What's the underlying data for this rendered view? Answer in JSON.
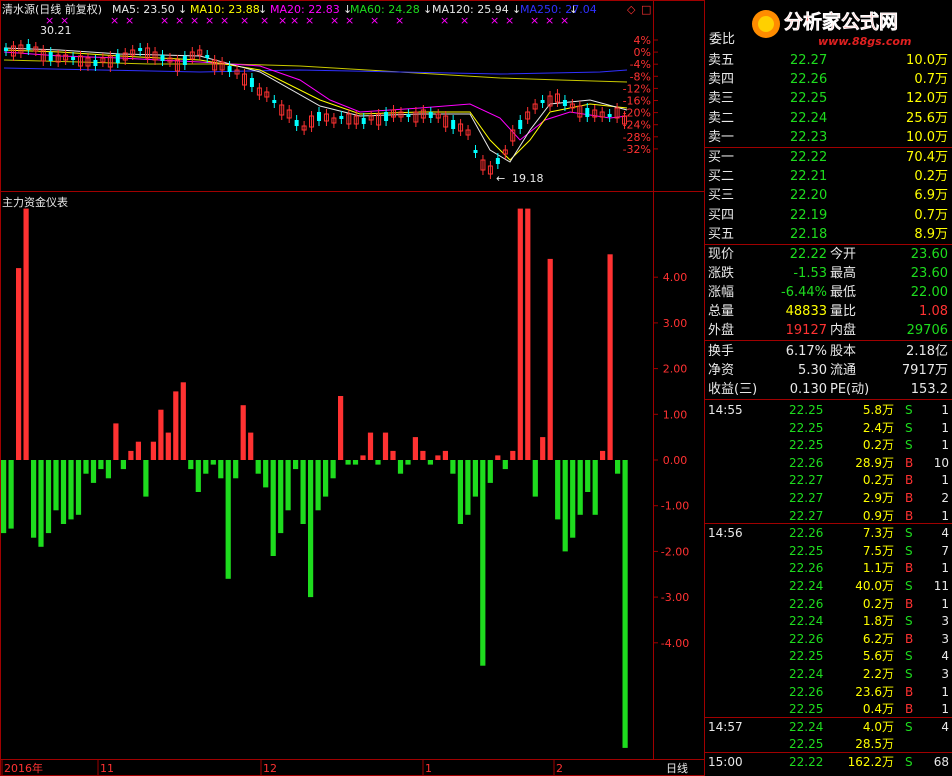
{
  "colors": {
    "red": "#ff3232",
    "green": "#1edc1e",
    "axis": "#a00000",
    "white": "#e8e8e8",
    "yellow": "#ffff00",
    "cyan": "#00ffff",
    "magenta": "#ff00ff",
    "blue": "#3030ff",
    "olive": "#c8c800",
    "label": "#c0c0c0"
  },
  "header": {
    "stock": "清水源(日线 前复权)",
    "ma5": "MA5: 23.50",
    "ma10": "MA10: 23.88",
    "ma20": "MA20: 22.83",
    "ma60": "MA60: 24.28",
    "ma120": "MA120: 25.94",
    "ma250": "MA250: 27.04"
  },
  "price_panel": {
    "high_label": "30.21",
    "low_label": "19.18",
    "pct_ticks": [
      "4%",
      "0%",
      "-4%",
      "-8%",
      "-12%",
      "-16%",
      "-20%",
      "-24%",
      "-28%",
      "-32%"
    ]
  },
  "indicator_panel": {
    "title": "主力资金仪表",
    "y_ticks": [
      "4.00",
      "3.00",
      "2.00",
      "1.00",
      "0.00",
      "-1.00",
      "-2.00",
      "-3.00",
      "-4.00"
    ]
  },
  "date_axis": {
    "labels": [
      "2016年",
      "11",
      "12",
      "1",
      "2"
    ],
    "period": "日线"
  },
  "chart_data": {
    "type": "bar",
    "title": "主力资金仪表",
    "ylim": [
      -6.3,
      5.3
    ],
    "values": [
      -1.6,
      -1.5,
      4.2,
      5.5,
      -1.7,
      -1.9,
      -1.6,
      -1.1,
      -1.4,
      -1.3,
      -1.2,
      -0.3,
      -0.5,
      -0.2,
      -0.4,
      0.8,
      -0.2,
      0.2,
      0.4,
      -0.8,
      0.4,
      1.1,
      0.6,
      1.5,
      1.7,
      -0.2,
      -0.7,
      -0.3,
      -0.1,
      -0.4,
      -2.6,
      -0.4,
      1.2,
      0.6,
      -0.3,
      -0.6,
      -2.1,
      -1.6,
      -1.1,
      -0.2,
      -1.4,
      -3.0,
      -1.1,
      -0.8,
      -0.4,
      1.4,
      -0.1,
      -0.1,
      0.1,
      0.6,
      -0.1,
      0.6,
      0.2,
      -0.3,
      -0.1,
      0.5,
      0.2,
      -0.1,
      0.1,
      0.2,
      -0.3,
      -1.4,
      -1.2,
      -0.8,
      -4.5,
      -0.5,
      0.1,
      -0.2,
      0.2,
      5.5,
      5.5,
      -0.8,
      0.5,
      4.4,
      -1.3,
      -2.0,
      -1.7,
      -1.2,
      -0.7,
      -1.2,
      0.2,
      4.5,
      -0.3,
      -6.3
    ]
  },
  "quote": {
    "webi_label": "委比",
    "asks": [
      {
        "label": "卖五",
        "price": "22.27",
        "vol": "10.0万"
      },
      {
        "label": "卖四",
        "price": "22.26",
        "vol": "0.7万"
      },
      {
        "label": "卖三",
        "price": "22.25",
        "vol": "12.0万"
      },
      {
        "label": "卖二",
        "price": "22.24",
        "vol": "25.6万"
      },
      {
        "label": "卖一",
        "price": "22.23",
        "vol": "10.0万"
      }
    ],
    "bids": [
      {
        "label": "买一",
        "price": "22.22",
        "vol": "70.4万"
      },
      {
        "label": "买二",
        "price": "22.21",
        "vol": "0.2万"
      },
      {
        "label": "买三",
        "price": "22.20",
        "vol": "6.9万"
      },
      {
        "label": "买四",
        "price": "22.19",
        "vol": "0.7万"
      },
      {
        "label": "买五",
        "price": "22.18",
        "vol": "8.9万"
      }
    ],
    "stats": [
      {
        "l1": "现价",
        "v1": "22.22",
        "l2": "今开",
        "v2": "23.60"
      },
      {
        "l1": "涨跌",
        "v1": "-1.53",
        "l2": "最高",
        "v2": "23.60"
      },
      {
        "l1": "涨幅",
        "v1": "-6.44%",
        "l2": "最低",
        "v2": "22.00"
      },
      {
        "l1": "总量",
        "v1": "48833",
        "l2": "量比",
        "v2": "1.08"
      },
      {
        "l1": "外盘",
        "v1": "19127",
        "l2": "内盘",
        "v2": "29706"
      }
    ],
    "fund": [
      {
        "l1": "换手",
        "v1": "6.17%",
        "l2": "股本",
        "v2": "2.18亿"
      },
      {
        "l1": "净资",
        "v1": "5.30",
        "l2": "流通",
        "v2": "7917万"
      },
      {
        "l1": "收益(三)",
        "v1": "0.130",
        "l2": "PE(动)",
        "v2": "153.2"
      }
    ],
    "ticks": [
      {
        "time": "14:55",
        "price": "22.25",
        "vol": "5.8万",
        "bs": "S",
        "n": "1"
      },
      {
        "time": "",
        "price": "22.25",
        "vol": "2.4万",
        "bs": "S",
        "n": "1"
      },
      {
        "time": "",
        "price": "22.25",
        "vol": "0.2万",
        "bs": "S",
        "n": "1"
      },
      {
        "time": "",
        "price": "22.26",
        "vol": "28.9万",
        "bs": "B",
        "n": "10"
      },
      {
        "time": "",
        "price": "22.27",
        "vol": "0.2万",
        "bs": "B",
        "n": "1"
      },
      {
        "time": "",
        "price": "22.27",
        "vol": "2.9万",
        "bs": "B",
        "n": "2"
      },
      {
        "time": "",
        "price": "22.27",
        "vol": "0.9万",
        "bs": "B",
        "n": "1"
      },
      {
        "time": "14:56",
        "price": "22.26",
        "vol": "7.3万",
        "bs": "S",
        "n": "4"
      },
      {
        "time": "",
        "price": "22.25",
        "vol": "7.5万",
        "bs": "S",
        "n": "7"
      },
      {
        "time": "",
        "price": "22.26",
        "vol": "1.1万",
        "bs": "B",
        "n": "1"
      },
      {
        "time": "",
        "price": "22.24",
        "vol": "40.0万",
        "bs": "S",
        "n": "11"
      },
      {
        "time": "",
        "price": "22.26",
        "vol": "0.2万",
        "bs": "B",
        "n": "1"
      },
      {
        "time": "",
        "price": "22.24",
        "vol": "1.8万",
        "bs": "S",
        "n": "3"
      },
      {
        "time": "",
        "price": "22.26",
        "vol": "6.2万",
        "bs": "B",
        "n": "3"
      },
      {
        "time": "",
        "price": "22.25",
        "vol": "5.6万",
        "bs": "S",
        "n": "4"
      },
      {
        "time": "",
        "price": "22.24",
        "vol": "2.2万",
        "bs": "S",
        "n": "3"
      },
      {
        "time": "",
        "price": "22.26",
        "vol": "23.6万",
        "bs": "B",
        "n": "1"
      },
      {
        "time": "",
        "price": "22.25",
        "vol": "0.4万",
        "bs": "B",
        "n": "1"
      },
      {
        "time": "14:57",
        "price": "22.24",
        "vol": "4.0万",
        "bs": "S",
        "n": "4"
      },
      {
        "time": "",
        "price": "22.25",
        "vol": "28.5万",
        "bs": "",
        "n": ""
      },
      {
        "time": "15:00",
        "price": "22.22",
        "vol": "162.2万",
        "bs": "S",
        "n": "68"
      }
    ]
  },
  "logo": {
    "brand": "分析家公式网",
    "url": "www.88gs.com"
  }
}
